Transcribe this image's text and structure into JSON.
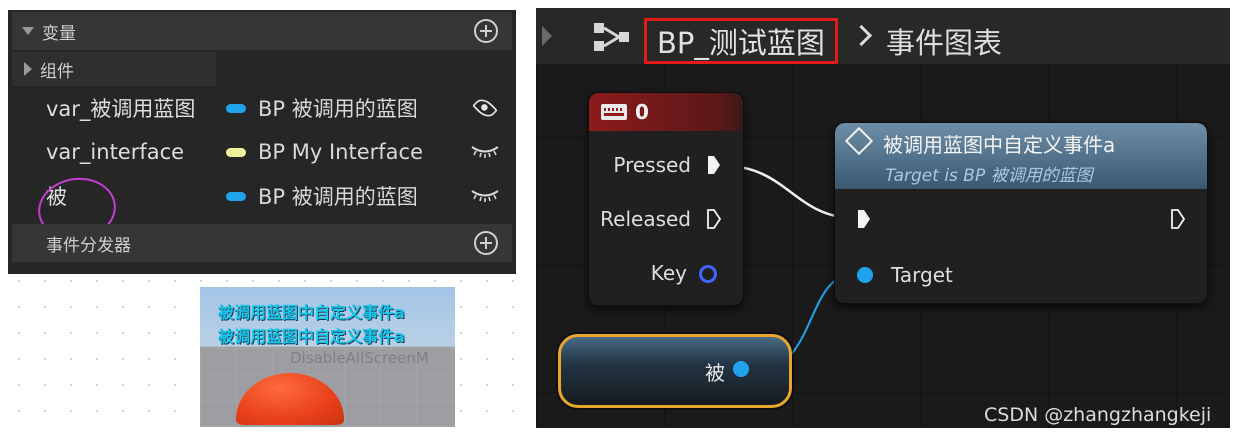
{
  "variables_panel": {
    "section_variables": "变量",
    "section_components": "组件",
    "section_dispatchers": "事件分发器",
    "rows": [
      {
        "name": "var_被调用蓝图",
        "type": "BP 被调用的蓝图",
        "type_color": "#1fa3ec",
        "visibility": "eye-open-icon"
      },
      {
        "name": "var_interface",
        "type": "BP My Interface",
        "type_color": "#f0f39c",
        "visibility": "eye-closed-icon"
      },
      {
        "name": "被",
        "type": "BP 被调用的蓝图",
        "type_color": "#1fa3ec",
        "visibility": "eye-closed-icon"
      }
    ],
    "annotation_color": "#c23fd0"
  },
  "viewport": {
    "print_lines": [
      "被调用蓝图中自定义事件a",
      "被调用蓝图中自定义事件a"
    ],
    "console_text": "DisableAllScreenM"
  },
  "graph": {
    "breadcrumb_title": "BP_测试蓝图",
    "breadcrumb_graph": "事件图表",
    "highlight_color": "#e21b1b",
    "key_node": {
      "title": "0",
      "pins": [
        "Pressed",
        "Released",
        "Key"
      ]
    },
    "event_node": {
      "title": "被调用蓝图中自定义事件a",
      "subtitle": "Target is BP 被调用的蓝图",
      "target_label": "Target"
    },
    "variable_node": {
      "label": "被",
      "border_color": "#e9a62e"
    }
  },
  "watermark": "CSDN @zhangzhangkeji"
}
